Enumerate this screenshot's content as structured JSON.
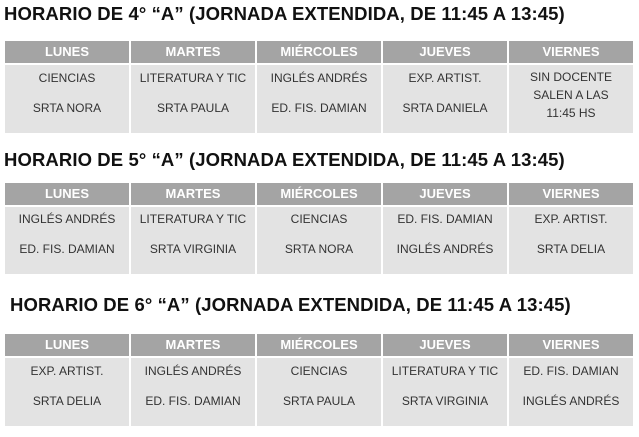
{
  "schedules": [
    {
      "title": "HORARIO DE 4° “A”  (JORNADA EXTENDIDA, DE 11:45 A 13:45)",
      "days": [
        "LUNES",
        "MARTES",
        "MIÉRCOLES",
        "JUEVES",
        "VIERNES"
      ],
      "cells": [
        [
          "CIENCIAS",
          "SRTA NORA"
        ],
        [
          "LITERATURA Y TIC",
          "SRTA PAULA"
        ],
        [
          "INGLÉS ANDRÉS",
          "ED. FIS. DAMIAN"
        ],
        [
          "EXP. ARTIST.",
          "SRTA DANIELA"
        ],
        [
          "SIN DOCENTE",
          "SALEN A LAS",
          "11:45 HS"
        ]
      ]
    },
    {
      "title": "HORARIO DE 5° “A”  (JORNADA EXTENDIDA, DE 11:45 A 13:45)",
      "days": [
        "LUNES",
        "MARTES",
        "MIÉRCOLES",
        "JUEVES",
        "VIERNES"
      ],
      "cells": [
        [
          "INGLÉS ANDRÉS",
          "ED. FIS. DAMIAN"
        ],
        [
          "LITERATURA Y TIC",
          "SRTA VIRGINIA"
        ],
        [
          "CIENCIAS",
          "SRTA NORA"
        ],
        [
          "ED. FIS. DAMIAN",
          "INGLÉS ANDRÉS"
        ],
        [
          "EXP. ARTIST.",
          "SRTA DELIA"
        ]
      ]
    },
    {
      "title": "HORARIO DE 6° “A”  (JORNADA EXTENDIDA, DE 11:45 A 13:45)",
      "days": [
        "LUNES",
        "MARTES",
        "MIÉRCOLES",
        "JUEVES",
        "VIERNES"
      ],
      "cells": [
        [
          "EXP. ARTIST.",
          "SRTA DELIA"
        ],
        [
          "INGLÉS ANDRÉS",
          "ED. FIS. DAMIAN"
        ],
        [
          "CIENCIAS",
          "SRTA PAULA"
        ],
        [
          "LITERATURA Y TIC",
          "SRTA VIRGINIA"
        ],
        [
          "ED. FIS. DAMIAN",
          "INGLÉS ANDRÉS"
        ]
      ]
    }
  ]
}
